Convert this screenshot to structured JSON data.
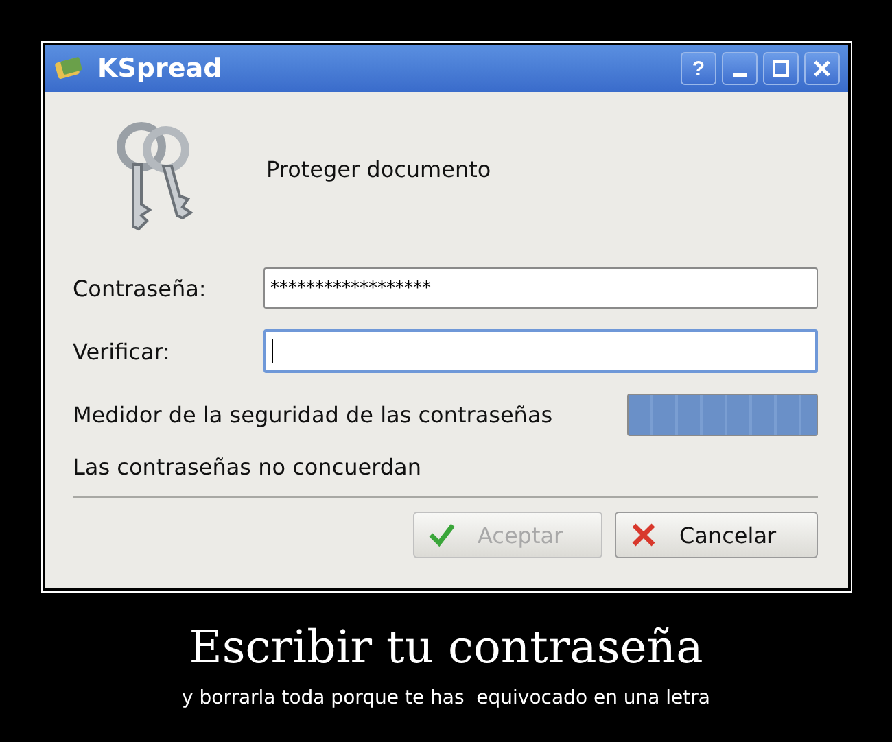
{
  "window": {
    "title": "KSpread",
    "help_label": "?"
  },
  "dialog": {
    "heading": "Proteger documento",
    "fields": [
      {
        "label": "Contraseña:",
        "value": "******************",
        "focused": false
      },
      {
        "label": "Verificar:",
        "focused": true
      }
    ],
    "strength": {
      "label": "Medidor de la seguridad de las contraseñas",
      "level": 1
    },
    "message": "Las contraseñas no concuerdan",
    "buttons": [
      {
        "label": "Aceptar",
        "kind": "ok",
        "disabled": true
      },
      {
        "label": "Cancelar",
        "kind": "cancel",
        "disabled": false
      }
    ]
  },
  "caption": {
    "title": "Escribir tu contraseña",
    "subtitle": "y borrarla toda porque te has  equivocado en una letra"
  }
}
